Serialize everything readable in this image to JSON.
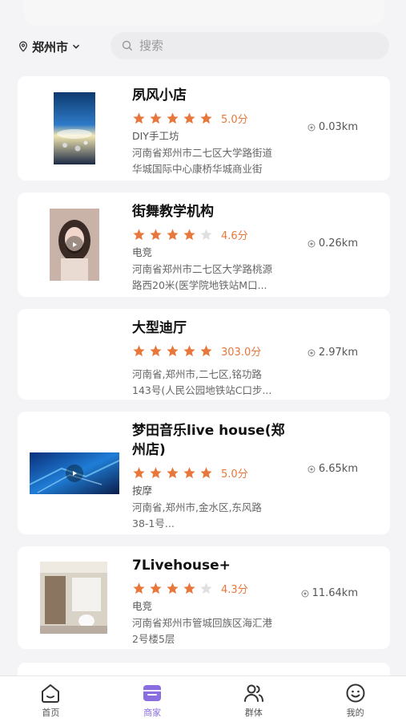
{
  "header": {
    "city": "郑州市",
    "search_placeholder": "搜索"
  },
  "stores": [
    {
      "name": "夙风小店",
      "name_line2": "",
      "stars": 5,
      "score": "5.0分",
      "category": "DIY手工坊",
      "address_line1": "河南省郑州市二七区大学路街道",
      "address_line2": "华城国际中心康桥华城商业街",
      "distance": "0.03km"
    },
    {
      "name": "街舞教学机构",
      "name_line2": "",
      "stars": 4,
      "score": "4.6分",
      "category": "电竞",
      "address_line1": "河南省郑州市二七区大学路桃源",
      "address_line2": "路西20米(医学院地铁站M口...",
      "distance": "0.26km"
    },
    {
      "name": "大型迪厅",
      "name_line2": "",
      "stars": 5,
      "score": "303.0分",
      "category": "",
      "address_line1": "河南省,郑州市,二七区,铭功路",
      "address_line2": "143号(人民公园地铁站C口步...",
      "distance": "2.97km"
    },
    {
      "name": "梦田音乐live house(郑",
      "name_line2": "州店)",
      "stars": 5,
      "score": "5.0分",
      "category": "按摩",
      "address_line1": "河南省,郑州市,金水区,东风路",
      "address_line2": "38-1号...",
      "distance": "6.65km"
    },
    {
      "name": "7Livehouse+",
      "name_line2": "",
      "stars": 4,
      "score": "4.3分",
      "category": "电竞",
      "address_line1": "河南省郑州市管城回族区海汇港",
      "address_line2": "2号楼5层",
      "distance": "11.64km"
    }
  ],
  "tabs": [
    {
      "label": "首页",
      "icon": "home-icon"
    },
    {
      "label": "商家",
      "icon": "shop-icon",
      "active": true
    },
    {
      "label": "群体",
      "icon": "group-icon"
    },
    {
      "label": "我的",
      "icon": "smile-icon"
    }
  ],
  "colors": {
    "star": "#e8773b",
    "star_empty": "#e0e0e0",
    "accent": "#8a6ee0"
  }
}
